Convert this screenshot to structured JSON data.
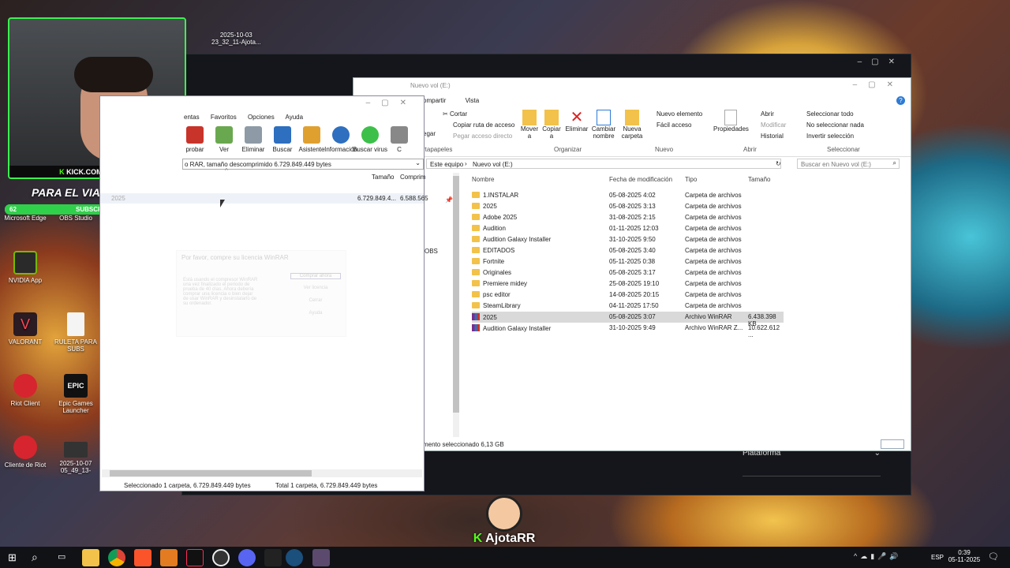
{
  "overlay": {
    "date_stamp": "2025-10-03",
    "date_stamp2": "23_32_11-Ajota...",
    "kick_url": "KICK.COM/AJOTARR",
    "goal_text": "PARA EL VIAJE EN FERO",
    "subs_current": "62",
    "subs_label": "SUBSCRIBERS",
    "subs_goal": "70",
    "streamer": "AjotaRR"
  },
  "desktop": {
    "icons": [
      "Microsoft Edge",
      "OBS Studio",
      "NVIDIA App",
      "VALORANT",
      "RULETA PARA SUBS",
      "Riot Client",
      "Epic Games Launcher",
      "Cliente de Riot",
      "2025-10-07 05_49_13-"
    ]
  },
  "explorer": {
    "title": "Nuevo vol (E:)",
    "tabs": [
      "ompartir",
      "Vista"
    ],
    "ribbon": {
      "cortar": "Cortar",
      "copiar_ruta": "Copiar ruta de acceso",
      "pegar_acceso": "Pegar acceso directo",
      "pegar": "egar",
      "mover": "Mover a",
      "copiar": "Copiar a",
      "eliminar": "Eliminar",
      "cambiar": "Cambiar nombre",
      "nueva_carpeta": "Nueva carpeta",
      "nuevo_elemento": "Nuevo elemento",
      "facil_acceso": "Fácil acceso",
      "propiedades": "Propiedades",
      "abrir": "Abrir",
      "modificar": "Modificar",
      "historial": "Historial",
      "sel_todo": "Seleccionar todo",
      "no_sel": "No seleccionar nada",
      "invertir": "Invertir selección",
      "groups": {
        "portapapeles": "rtapapeles",
        "organizar": "Organizar",
        "nuevo": "Nuevo",
        "abrir": "Abrir",
        "seleccionar": "Seleccionar"
      }
    },
    "address": {
      "part1": "Este equipo",
      "part2": "Nuevo vol (E:)"
    },
    "search_placeholder": "Buscar en Nuevo vol (E:)",
    "columns": {
      "name": "Nombre",
      "date": "Fecha de modificación",
      "type": "Tipo",
      "size": "Tamaño"
    },
    "rows": [
      {
        "name": "1.INSTALAR",
        "date": "05-08-2025 4:02",
        "type": "Carpeta de archivos",
        "size": "",
        "kind": "folder"
      },
      {
        "name": "2025",
        "date": "05-08-2025 3:13",
        "type": "Carpeta de archivos",
        "size": "",
        "kind": "folder"
      },
      {
        "name": "Adobe 2025",
        "date": "31-08-2025 2:15",
        "type": "Carpeta de archivos",
        "size": "",
        "kind": "folder"
      },
      {
        "name": "Audition",
        "date": "01-11-2025 12:03",
        "type": "Carpeta de archivos",
        "size": "",
        "kind": "folder"
      },
      {
        "name": "Audition Galaxy Installer",
        "date": "31-10-2025 9:50",
        "type": "Carpeta de archivos",
        "size": "",
        "kind": "folder"
      },
      {
        "name": "EDITADOS",
        "date": "05-08-2025 3:40",
        "type": "Carpeta de archivos",
        "size": "",
        "kind": "folder"
      },
      {
        "name": "Fortnite",
        "date": "05-11-2025 0:38",
        "type": "Carpeta de archivos",
        "size": "",
        "kind": "folder"
      },
      {
        "name": "Originales",
        "date": "05-08-2025 3:17",
        "type": "Carpeta de archivos",
        "size": "",
        "kind": "folder"
      },
      {
        "name": "Premiere midey",
        "date": "25-08-2025 19:10",
        "type": "Carpeta de archivos",
        "size": "",
        "kind": "folder"
      },
      {
        "name": "psc editor",
        "date": "14-08-2025 20:15",
        "type": "Carpeta de archivos",
        "size": "",
        "kind": "folder"
      },
      {
        "name": "SteamLibrary",
        "date": "04-11-2025 17:50",
        "type": "Carpeta de archivos",
        "size": "",
        "kind": "folder"
      },
      {
        "name": "2025",
        "date": "05-08-2025 3:07",
        "type": "Archivo WinRAR",
        "size": "6.438.398 KB",
        "kind": "rar"
      },
      {
        "name": "Audition Galaxy Installer",
        "date": "31-10-2025 9:49",
        "type": "Archivo WinRAR Z...",
        "size": "10.622.612 ...",
        "kind": "rar"
      }
    ],
    "status": "mento seleccionado  6,13 GB",
    "side_obs": "OBS"
  },
  "winrar": {
    "menu": [
      "entas",
      "Favoritos",
      "Opciones",
      "Ayuda"
    ],
    "tools": [
      "probar",
      "Ver",
      "Eliminar",
      "Buscar",
      "Asistente",
      "Información",
      "Buscar virus",
      "C"
    ],
    "path": "o RAR, tamaño descomprimido 6.729.849.449 bytes",
    "col_size": "Tamaño",
    "col_comp": "Comprim",
    "row_size": "6.729.849.4...",
    "row_comp": "6.588.565",
    "row_name": "2025",
    "status_left": "Seleccionado 1 carpeta, 6.729.849.449 bytes",
    "status_right": "Total 1 carpeta, 6.729.849.449 bytes",
    "dialog": {
      "title": "Por favor, compre su licencia WinRAR",
      "body": "Está usando el compresor WinRAR una vez finalizado el periodo de prueba de 40 días. Ahora debería comprar una licencia o bien dejar de usar WinRAR y desinstalarlo de su ordenador.",
      "buttons": [
        "Comprar ahora",
        "Ver licencia",
        "Cerrar",
        "Ayuda"
      ]
    }
  },
  "launcher": {
    "plataforma": "Plataforma"
  },
  "taskbar": {
    "lang": "ESP",
    "time": "0:39",
    "date": "05-11-2025"
  }
}
